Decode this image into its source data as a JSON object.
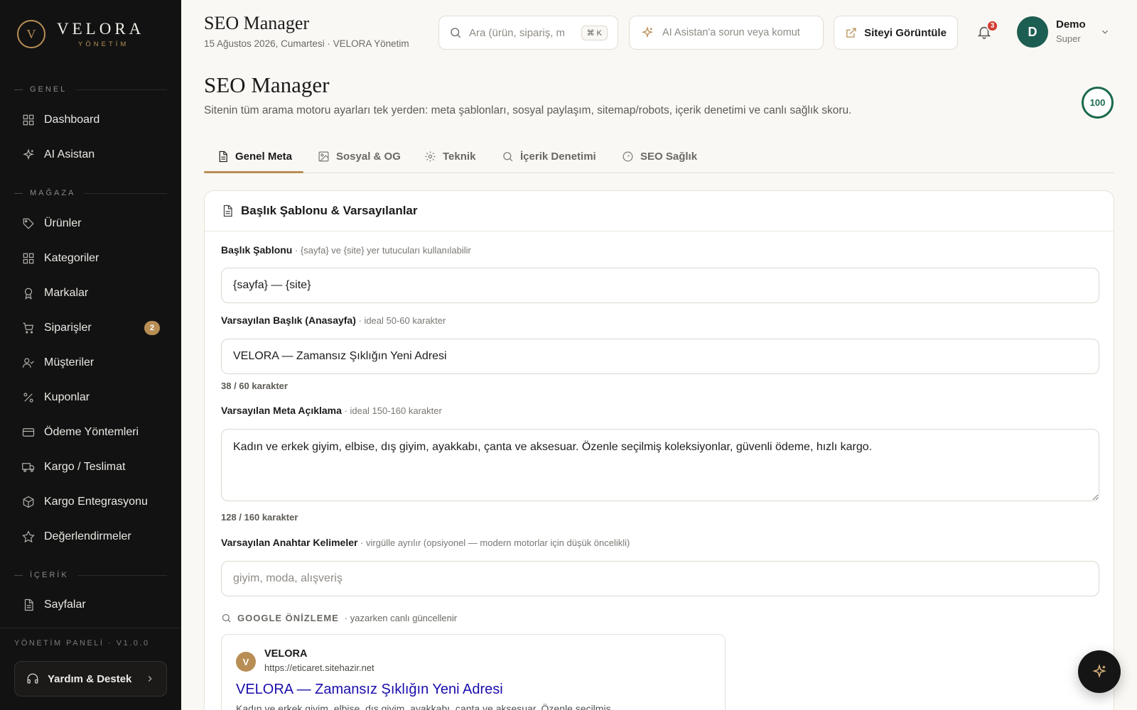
{
  "brand": {
    "name": "VELORA",
    "sub": "YÖNETİM",
    "mark": "V"
  },
  "sidebar": {
    "sections": [
      "GENEL",
      "MAĞAZA",
      "İÇERİK"
    ],
    "items": [
      {
        "label": "Dashboard",
        "icon": "grid-icon"
      },
      {
        "label": "AI Asistan",
        "icon": "sparkle-icon"
      },
      {
        "label": "Ürünler",
        "icon": "tag-icon"
      },
      {
        "label": "Kategoriler",
        "icon": "grid-icon"
      },
      {
        "label": "Markalar",
        "icon": "award-icon"
      },
      {
        "label": "Siparişler",
        "icon": "cart-icon",
        "badge": "2"
      },
      {
        "label": "Müşteriler",
        "icon": "user-check-icon"
      },
      {
        "label": "Kuponlar",
        "icon": "percent-icon"
      },
      {
        "label": "Ödeme Yöntemleri",
        "icon": "card-icon"
      },
      {
        "label": "Kargo / Teslimat",
        "icon": "truck-icon"
      },
      {
        "label": "Kargo Entegrasyonu",
        "icon": "box-icon"
      },
      {
        "label": "Değerlendirmeler",
        "icon": "star-icon"
      },
      {
        "label": "Sayfalar",
        "icon": "file-icon"
      }
    ],
    "version": "YÖNETİM PANELİ · V1.0.0",
    "help": "Yardım & Destek"
  },
  "topbar": {
    "title": "SEO Manager",
    "subtitle": "15 Ağustos 2026, Cumartesi · VELORA Yönetim",
    "search_placeholder": "Ara (ürün, sipariş, m",
    "search_kbd": "⌘ K",
    "ai_placeholder": "AI Asistan'a sorun veya komut",
    "view_site": "Siteyi Görüntüle",
    "notifications": "3",
    "user": {
      "initial": "D",
      "name": "Demo",
      "role": "Super"
    }
  },
  "page": {
    "title": "SEO Manager",
    "description": "Sitenin tüm arama motoru ayarları tek yerden: meta şablonları, sosyal paylaşım, sitemap/robots, içerik denetimi ve canlı sağlık skoru.",
    "score": "100"
  },
  "tabs": [
    {
      "label": "Genel Meta",
      "icon": "file-icon",
      "active": true
    },
    {
      "label": "Sosyal & OG",
      "icon": "image-icon"
    },
    {
      "label": "Teknik",
      "icon": "gear-icon"
    },
    {
      "label": "İçerik Denetimi",
      "icon": "search-icon"
    },
    {
      "label": "SEO Sağlık",
      "icon": "gauge-icon"
    }
  ],
  "card": {
    "title": "Başlık Şablonu & Varsayılanlar",
    "fields": {
      "template": {
        "label": "Başlık Şablonu",
        "hint": " · {sayfa} ve {site} yer tutucuları kullanılabilir",
        "value": "{sayfa} — {site}"
      },
      "default_title": {
        "label": "Varsayılan Başlık (Anasayfa)",
        "hint": " · ideal 50-60 karakter",
        "value": "VELORA — Zamansız Şıklığın Yeni Adresi",
        "count": "38 / 60 karakter"
      },
      "meta_desc": {
        "label": "Varsayılan Meta Açıklama",
        "hint": " · ideal 150-160 karakter",
        "value": "Kadın ve erkek giyim, elbise, dış giyim, ayakkabı, çanta ve aksesuar. Özenle seçilmiş koleksiyonlar, güvenli ödeme, hızlı kargo.",
        "count": "128 / 160 karakter"
      },
      "keywords": {
        "label": "Varsayılan Anahtar Kelimeler",
        "hint": " · virgülle ayrılır (opsiyonel — modern motorlar için düşük öncelikli)",
        "placeholder": "giyim, moda, alışveriş"
      }
    },
    "preview": {
      "label": "GOOGLE ÖNİZLEME",
      "hint": "· yazarken canlı güncellenir",
      "fav": "V",
      "site": "VELORA",
      "url": "https://eticaret.sitehazir.net",
      "title": "VELORA — Zamansız Şıklığın Yeni Adresi",
      "desc": "Kadın ve erkek giyim, elbise, dış giyim, ayakkabı, çanta ve aksesuar. Özenle seçilmiş"
    }
  },
  "colors": {
    "accent": "#b88e55",
    "sidebar": "#121212",
    "brand_green": "#1d5e52",
    "link": "#1a0dab"
  }
}
